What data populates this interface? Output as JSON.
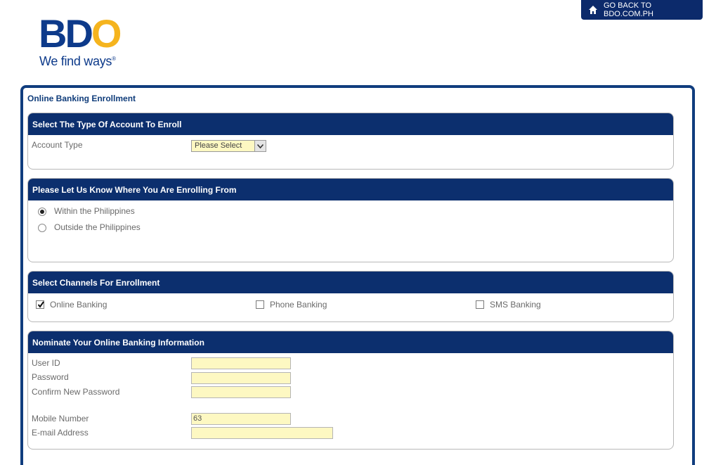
{
  "brand": {
    "logo_letters": [
      "B",
      "D",
      "O"
    ],
    "tagline": "We find ways",
    "tagline_mark": "®",
    "primary_color": "#0d3a8a",
    "accent_color": "#f5b41e"
  },
  "header": {
    "go_back_label": "GO BACK TO BDO.COM.PH",
    "go_back_icon": "home-icon"
  },
  "page": {
    "title": "Online Banking Enrollment"
  },
  "account_type_section": {
    "heading": "Select The Type Of Account To Enroll",
    "account_type_label": "Account Type",
    "account_type_value": "Please Select"
  },
  "location_section": {
    "heading": "Please Let Us Know Where You Are Enrolling From",
    "options": [
      {
        "label": "Within the Philippines",
        "selected": true
      },
      {
        "label": "Outside the Philippines",
        "selected": false
      }
    ]
  },
  "channels_section": {
    "heading": "Select Channels For Enrollment",
    "channels": [
      {
        "label": "Online Banking",
        "checked": true
      },
      {
        "label": "Phone Banking",
        "checked": false
      },
      {
        "label": "SMS Banking",
        "checked": false
      }
    ]
  },
  "online_info_section": {
    "heading": "Nominate Your Online Banking Information",
    "user_id_label": "User ID",
    "user_id_value": "",
    "password_label": "Password",
    "password_value": "",
    "confirm_password_label": "Confirm New Password",
    "confirm_password_value": "",
    "mobile_label": "Mobile Number",
    "mobile_value": "63",
    "email_label": "E-mail Address",
    "email_value": ""
  }
}
